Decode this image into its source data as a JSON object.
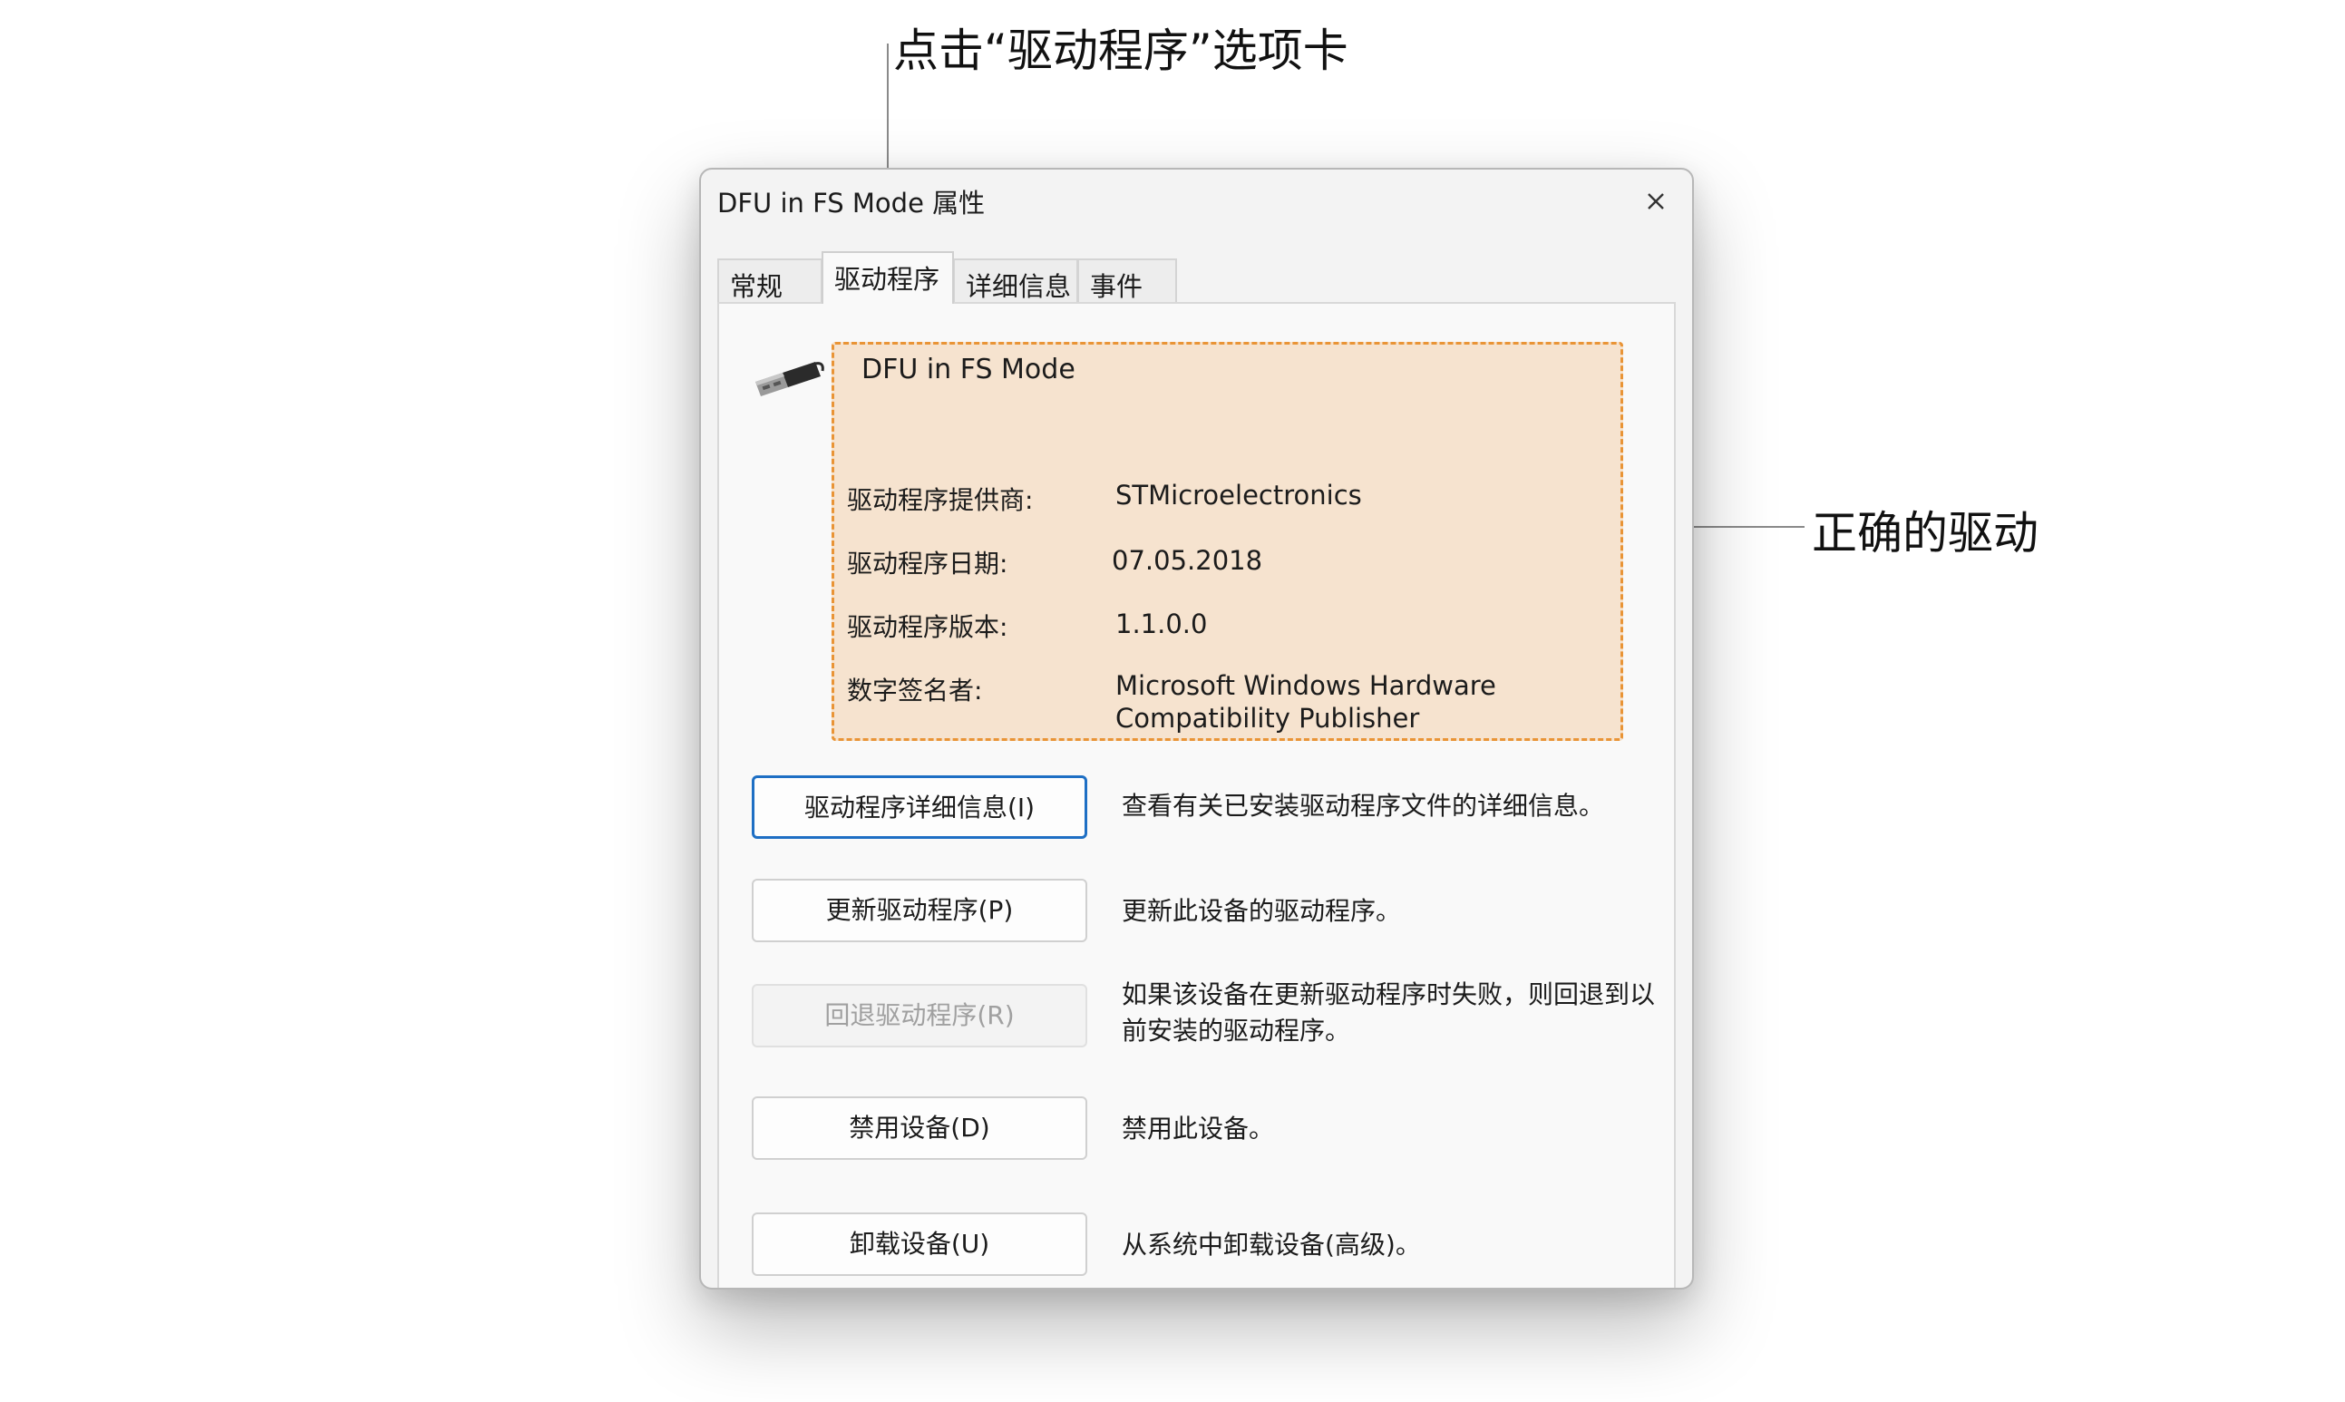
{
  "annotations": {
    "top": "点击“驱动程序”选项卡",
    "right": "正确的驱动"
  },
  "dialog": {
    "title": "DFU in FS Mode 属性",
    "close_icon": "close-icon",
    "tabs": [
      {
        "label": "常规",
        "active": false
      },
      {
        "label": "驱动程序",
        "active": true
      },
      {
        "label": "详细信息",
        "active": false
      },
      {
        "label": "事件",
        "active": false
      }
    ],
    "device_icon": "usb-plug-icon",
    "device_name": "DFU in FS Mode",
    "info": {
      "provider_label": "驱动程序提供商:",
      "provider_value": "STMicroelectronics",
      "date_label": "驱动程序日期:",
      "date_value": "07.05.2018",
      "version_label": "驱动程序版本:",
      "version_value": "1.1.0.0",
      "signer_label": "数字签名者:",
      "signer_value": "Microsoft Windows Hardware Compatibility Publisher"
    },
    "actions": [
      {
        "label": "驱动程序详细信息(I)",
        "description": "查看有关已安装驱动程序文件的详细信息。",
        "enabled": true
      },
      {
        "label": "更新驱动程序(P)",
        "description": "更新此设备的驱动程序。",
        "enabled": true
      },
      {
        "label": "回退驱动程序(R)",
        "description": "如果该设备在更新驱动程序时失败，则回退到以前安装的驱动程序。",
        "enabled": false
      },
      {
        "label": "禁用设备(D)",
        "description": "禁用此设备。",
        "enabled": true
      },
      {
        "label": "卸载设备(U)",
        "description": "从系统中卸载设备(高级)。",
        "enabled": true
      }
    ],
    "colors": {
      "highlight_fill": "#f6e3cf",
      "highlight_border": "#e99436",
      "focus_border": "#1e6fc4"
    }
  }
}
